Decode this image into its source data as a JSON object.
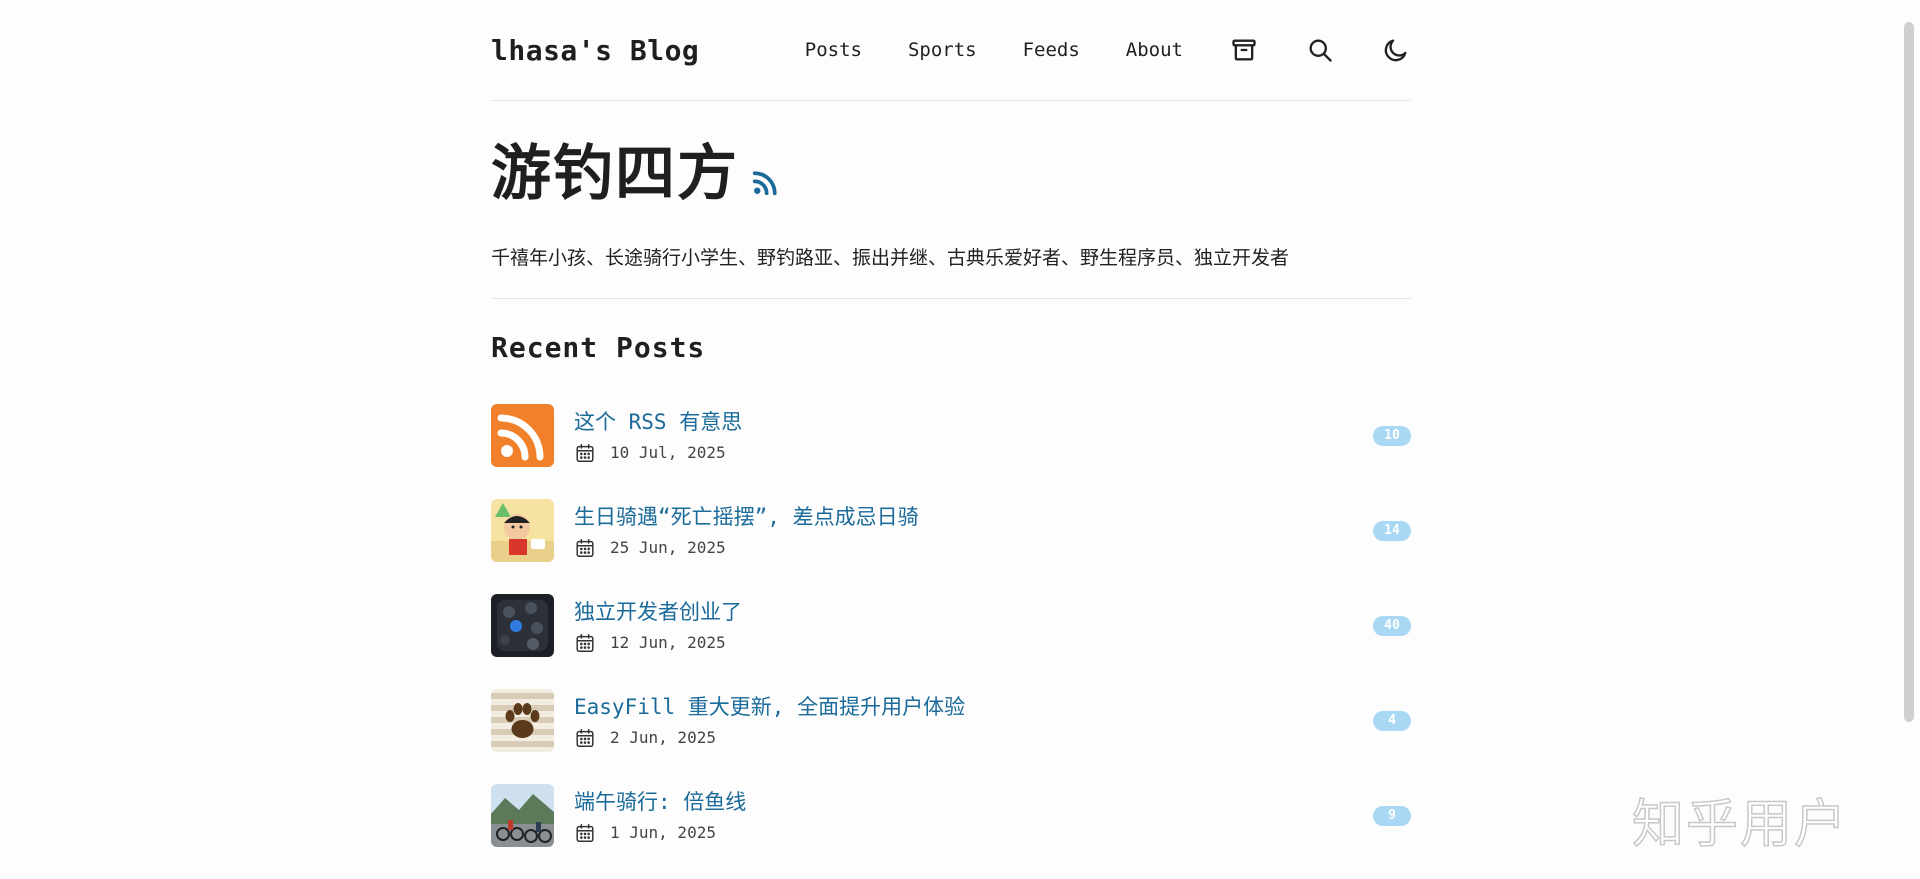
{
  "site": {
    "logo": "lhasa's Blog"
  },
  "nav": {
    "links": [
      "Posts",
      "Sports",
      "Feeds",
      "About"
    ],
    "icons": [
      "archive-icon",
      "search-icon",
      "moon-icon"
    ]
  },
  "hero": {
    "title": "游钓四方",
    "description": "千禧年小孩、长途骑行小学生、野钓路亚、振出并继、古典乐爱好者、野生程序员、独立开发者"
  },
  "recent": {
    "heading": "Recent Posts",
    "posts": [
      {
        "title": "这个 RSS 有意思",
        "date": "10 Jul, 2025",
        "count": "10",
        "thumb": "rss"
      },
      {
        "title": "生日骑遇“死亡摇摆”, 差点成忌日骑",
        "date": "25 Jun, 2025",
        "count": "14",
        "thumb": "cartoon"
      },
      {
        "title": "独立开发者创业了",
        "date": "12 Jun, 2025",
        "count": "40",
        "thumb": "phone"
      },
      {
        "title": "EasyFill 重大更新, 全面提升用户体验",
        "date": "2 Jun, 2025",
        "count": "4",
        "thumb": "paw"
      },
      {
        "title": "端午骑行: 倍鱼线",
        "date": "1 Jun, 2025",
        "count": "9",
        "thumb": "bikes"
      }
    ]
  },
  "watermark": "知乎用户",
  "colors": {
    "link": "#1a6a9a",
    "badge": "#a9d8f5",
    "rss_orange": "#f0812a"
  }
}
